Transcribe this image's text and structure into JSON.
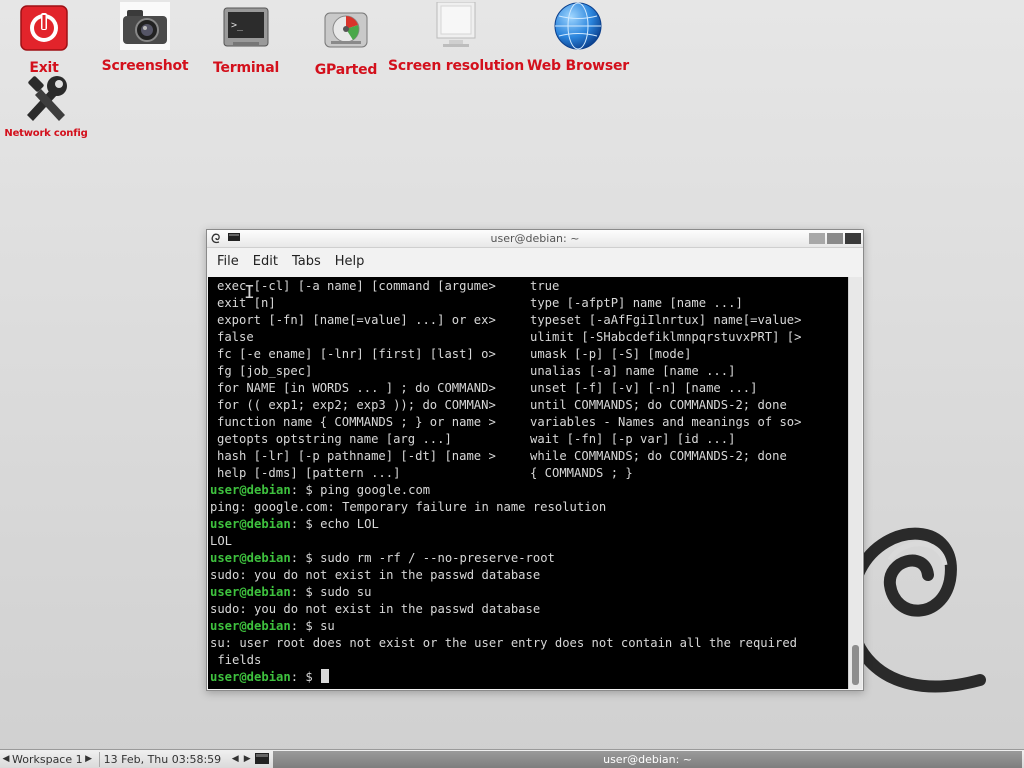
{
  "desktop": {
    "icons": [
      {
        "label": "Exit",
        "icon": "power-icon"
      },
      {
        "label": "Screenshot",
        "icon": "camera-icon"
      },
      {
        "label": "Terminal",
        "icon": "terminal-icon"
      },
      {
        "label": "GParted",
        "icon": "disk-icon"
      },
      {
        "label": "Screen resolution",
        "icon": "monitor-icon"
      },
      {
        "label": "Web Browser",
        "icon": "globe-icon"
      },
      {
        "label": "Network config",
        "icon": "wrench-icon"
      }
    ]
  },
  "terminal": {
    "title": "user@debian: ~",
    "menu": [
      "File",
      "Edit",
      "Tabs",
      "Help"
    ],
    "help_rows": [
      [
        "exec [-cl] [-a name] [command [argume>",
        "true"
      ],
      [
        "exit [n]",
        "type [-afptP] name [name ...]"
      ],
      [
        "export [-fn] [name[=value] ...] or ex>",
        "typeset [-aAfFgiIlnrtux] name[=value>"
      ],
      [
        "false",
        "ulimit [-SHabcdefiklmnpqrstuvxPRT] [>"
      ],
      [
        "fc [-e ename] [-lnr] [first] [last] o>",
        "umask [-p] [-S] [mode]"
      ],
      [
        "fg [job_spec]",
        "unalias [-a] name [name ...]"
      ],
      [
        "for NAME [in WORDS ... ] ; do COMMAND>",
        "unset [-f] [-v] [-n] [name ...]"
      ],
      [
        "for (( exp1; exp2; exp3 )); do COMMAN>",
        "until COMMANDS; do COMMANDS-2; done"
      ],
      [
        "function name { COMMANDS ; } or name >",
        "variables - Names and meanings of so>"
      ],
      [
        "getopts optstring name [arg ...]",
        "wait [-fn] [-p var] [id ...]"
      ],
      [
        "hash [-lr] [-p pathname] [-dt] [name >",
        "while COMMANDS; do COMMANDS-2; done"
      ],
      [
        "help [-dms] [pattern ...]",
        "{ COMMANDS ; }"
      ]
    ],
    "prompt_user": "user@debian",
    "prompt_suffix": ": $ ",
    "session": [
      {
        "type": "cmd",
        "text": "ping google.com"
      },
      {
        "type": "out",
        "text": "ping: google.com: Temporary failure in name resolution"
      },
      {
        "type": "cmd",
        "text": "echo LOL"
      },
      {
        "type": "out",
        "text": "LOL"
      },
      {
        "type": "cmd",
        "text": "sudo rm -rf / --no-preserve-root"
      },
      {
        "type": "out",
        "text": "sudo: you do not exist in the passwd database"
      },
      {
        "type": "cmd",
        "text": "sudo su"
      },
      {
        "type": "out",
        "text": "sudo: you do not exist in the passwd database"
      },
      {
        "type": "cmd",
        "text": "su"
      },
      {
        "type": "out",
        "text": "su: user root does not exist or the user entry does not contain all the required"
      },
      {
        "type": "out",
        "text": " fields"
      },
      {
        "type": "cmd",
        "text": ""
      }
    ]
  },
  "taskbar": {
    "workspace": "Workspace 1",
    "datetime": "13 Feb, Thu 03:58:59",
    "task_title": "user@debian: ~"
  }
}
